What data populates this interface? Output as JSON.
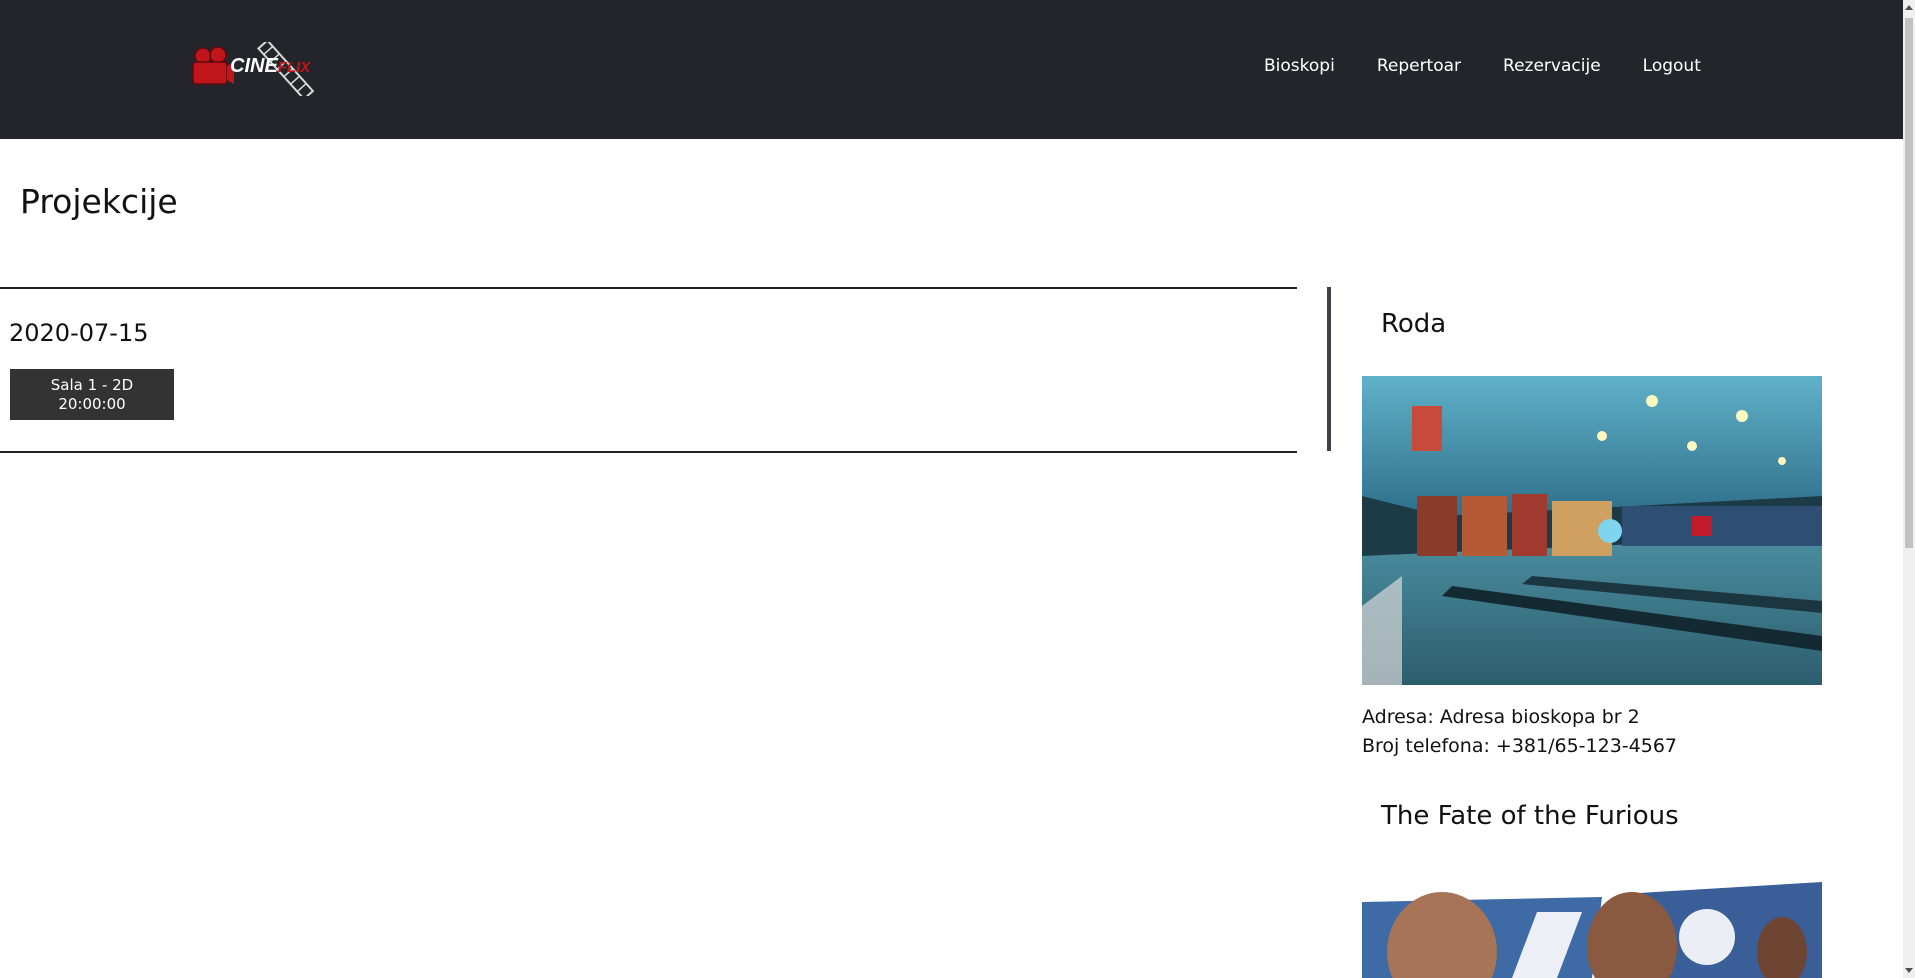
{
  "header": {
    "logo": {
      "text_main": "CINE",
      "text_accent": "FLIX",
      "icon": "film-camera-icon"
    },
    "nav": [
      {
        "label": "Bioskopi"
      },
      {
        "label": "Repertoar"
      },
      {
        "label": "Rezervacije"
      },
      {
        "label": "Logout"
      }
    ]
  },
  "main": {
    "title": "Projekcije",
    "projections": [
      {
        "date": "2020-07-15",
        "slots": [
          {
            "hall": "Sala 1 - 2D",
            "time": "20:00:00"
          }
        ]
      }
    ]
  },
  "sidebar": {
    "cinema": {
      "name": "Roda",
      "image_icon": "cinema-lobby-photo",
      "address": "Adresa: Adresa bioskopa br 2",
      "phone": "Broj telefona: +381/65-123-4567"
    },
    "movie": {
      "title": "The Fate of the Furious",
      "image_icon": "movie-poster-photo"
    }
  },
  "colors": {
    "navbar_bg": "#24252a",
    "accent": "#c0161b",
    "button_bg": "#333333"
  }
}
